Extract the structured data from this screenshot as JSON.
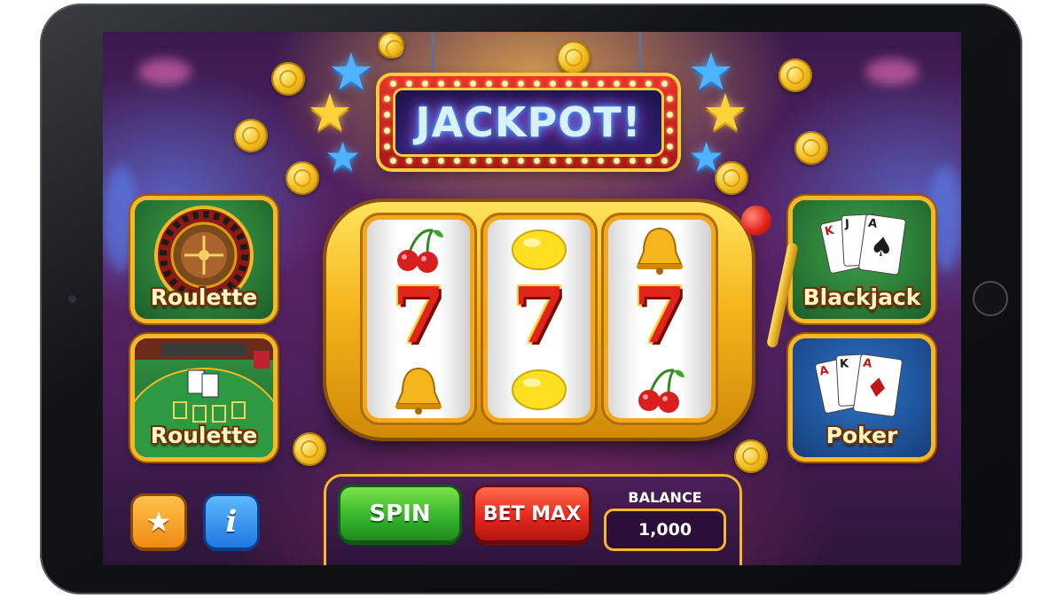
{
  "banner": {
    "title": "JACKPOT!"
  },
  "games_left": [
    {
      "label": "Roulette",
      "kind": "roulette-wheel"
    },
    {
      "label": "Roulette",
      "kind": "card-table"
    }
  ],
  "games_right": [
    {
      "label": "Blackjack",
      "cards": [
        "K",
        "J",
        "A"
      ]
    },
    {
      "label": "Poker",
      "cards": [
        "A",
        "K",
        "A"
      ]
    }
  ],
  "reels": [
    {
      "top": "cherries",
      "middle": "7",
      "bottom": "bell"
    },
    {
      "top": "lemon",
      "middle": "7",
      "bottom": "lemon"
    },
    {
      "top": "bell",
      "middle": "7",
      "bottom": "cherries"
    }
  ],
  "controls": {
    "spin_label": "SPIN",
    "bet_max_label": "BET MAX",
    "balance_label": "BALANCE",
    "balance_value": "1,000"
  },
  "icons": {
    "favorite": "star-icon",
    "info": "info-icon"
  },
  "colors": {
    "gold": "#f6b824",
    "spin_green": "#36b62c",
    "bet_red": "#e5291f",
    "neon_blue": "#3fb0ff"
  }
}
